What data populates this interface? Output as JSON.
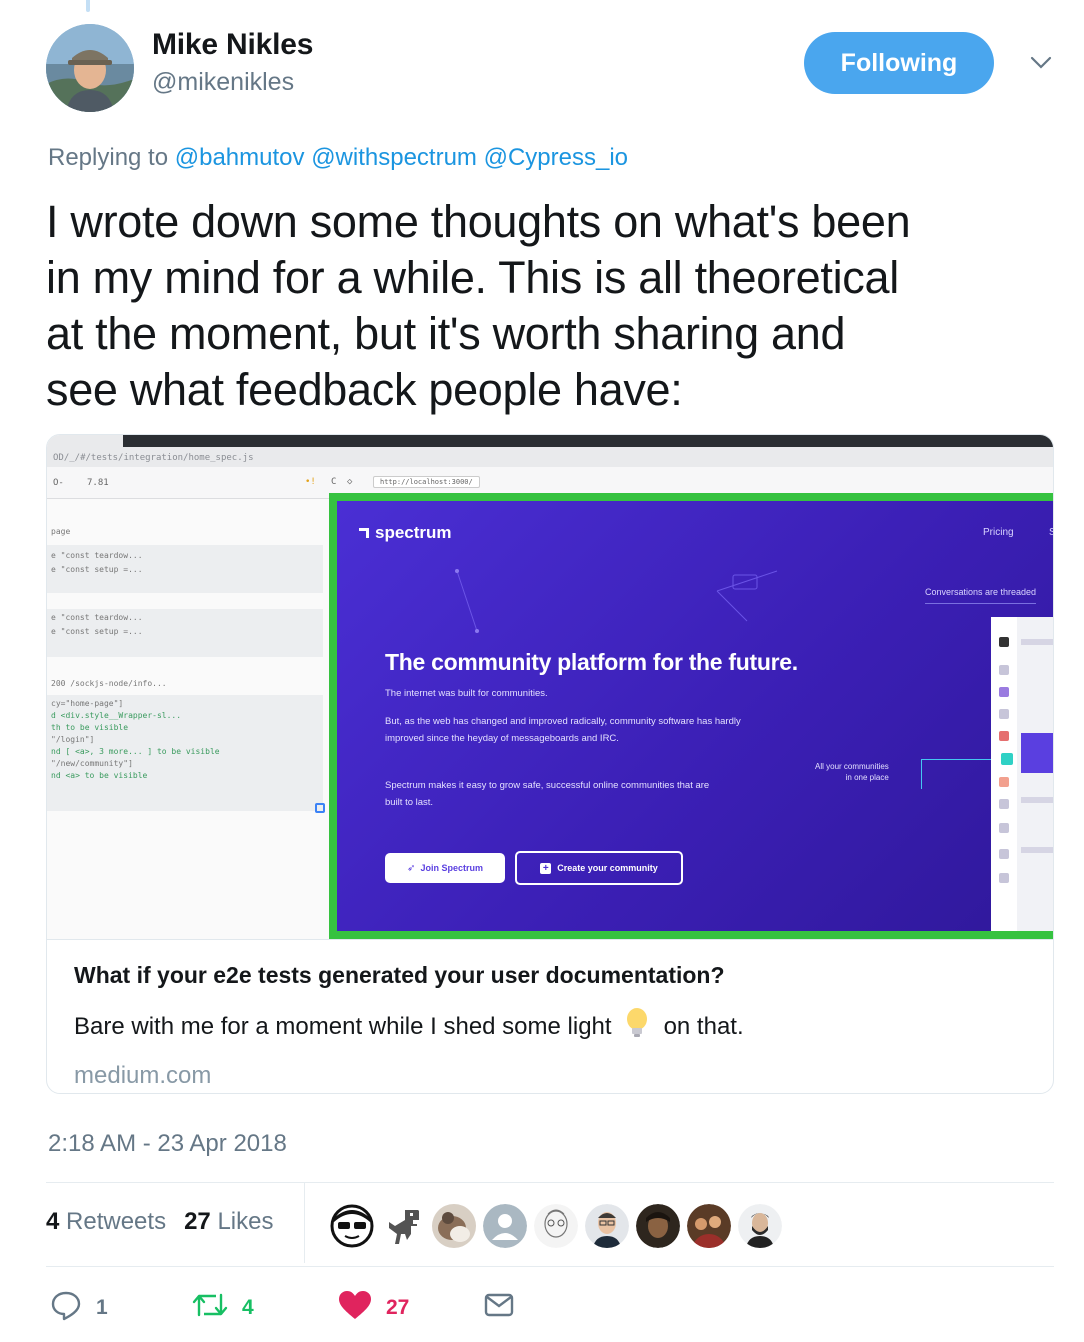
{
  "author": {
    "display_name": "Mike Nikles",
    "handle": "@mikenikles"
  },
  "follow_button": {
    "label": "Following",
    "color": "#4aa6ee"
  },
  "reply": {
    "prefix": "Replying to",
    "mentions": [
      "@bahmutov",
      "@withspectrum",
      "@Cypress_io"
    ]
  },
  "tweet": {
    "text_lines": [
      "I wrote down some thoughts on what's been",
      "in my mind for a while. This is all theoretical",
      "at the moment, but it's worth sharing and",
      "see what feedback people have:"
    ]
  },
  "card": {
    "title": "What if your e2e tests generated your user documentation?",
    "description_before": "Bare with me for a moment while I shed some light",
    "description_icon": "lightbulb-emoji",
    "description_after": "on that.",
    "domain": "medium.com",
    "screenshot": {
      "url_path": "OD/_/#/tests/integration/home_spec.js",
      "test_count": "7.81",
      "address": "http://localhost:3000/",
      "left_label": "page",
      "commands_group1": [
        "e  \"const teardow...",
        "e  \"const setup =..."
      ],
      "commands_group2": [
        "e  \"const teardow...",
        "e  \"const setup =..."
      ],
      "xhr_line": "200 /sockjs-node/info...",
      "commands_group3": [
        "cy=\"home-page\"]",
        "d  <div.style__Wrapper-sl...",
        "th  to be visible",
        "\"/login\"]",
        "nd  [ <a>, 3 more... ]  to be visible",
        "\"/new/community\"]",
        "nd  <a>  to be visible"
      ],
      "brand": "spectrum",
      "nav_pricing": "Pricing",
      "nav_s": "S",
      "threaded_tag": "Conversations are threaded",
      "hero_title": "The community platform for the future.",
      "hero_p1": "The internet was built for communities.",
      "hero_p2": "But, as the web has changed and improved radically, community software has hardly improved since the heyday of messageboards and IRC.",
      "hero_p3": "Spectrum makes it easy to grow safe, successful online communities that are built to last.",
      "btn_join": "Join Spectrum",
      "btn_create": "Create your community",
      "callout_line1": "All your communities",
      "callout_line2": "in one place"
    }
  },
  "timestamp": "2:18 AM - 23 Apr 2018",
  "stats": {
    "retweets_count": "4",
    "retweets_label": "Retweets",
    "likes_count": "27",
    "likes_label": "Likes"
  },
  "likers": [
    "sunglasses-face-avatar",
    "dinosaur-avatar",
    "cat-photo-avatar",
    "default-avatar",
    "sketch-portrait-avatar",
    "man-glasses-avatar",
    "dark-photo-avatar",
    "group-photo-avatar",
    "bearded-man-avatar"
  ],
  "actions": {
    "reply_count": "1",
    "retweet_count": "4",
    "like_count": "27",
    "colors": {
      "reply": "#657786",
      "retweet": "#17bf63",
      "like": "#e0245e",
      "dm": "#657786"
    }
  }
}
